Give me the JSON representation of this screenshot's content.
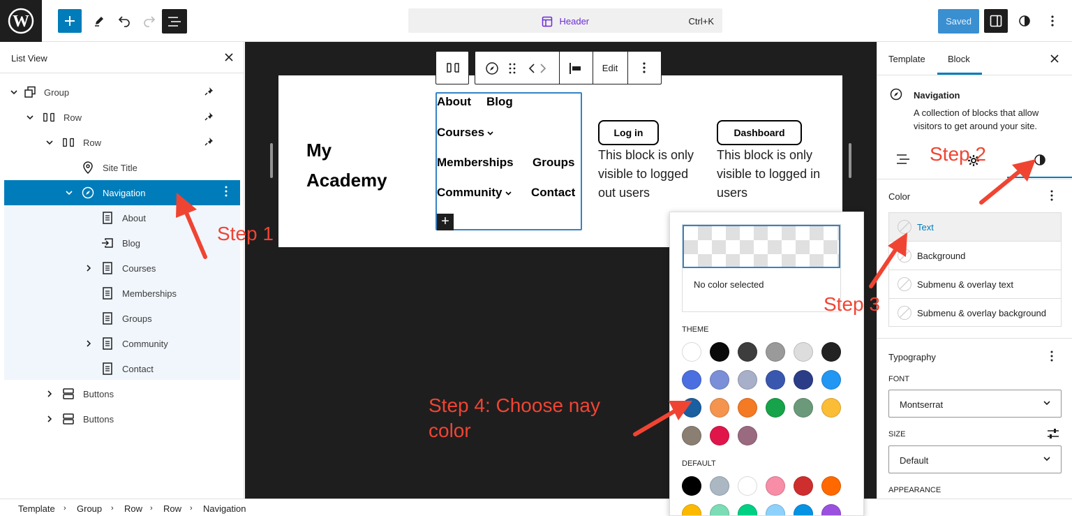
{
  "topbar": {
    "command_title": "Header",
    "command_shortcut": "Ctrl+K",
    "saved_label": "Saved"
  },
  "list_view": {
    "title": "List View",
    "items": [
      {
        "label": "Group",
        "icon": "group-icon"
      },
      {
        "label": "Row",
        "icon": "row-icon"
      },
      {
        "label": "Row",
        "icon": "row-icon"
      },
      {
        "label": "Site Title",
        "icon": "map-marker-icon"
      },
      {
        "label": "Navigation",
        "icon": "compass-icon",
        "selected": true
      },
      {
        "label": "About",
        "icon": "page-icon"
      },
      {
        "label": "Blog",
        "icon": "custom-link-icon"
      },
      {
        "label": "Courses",
        "icon": "page-icon"
      },
      {
        "label": "Memberships",
        "icon": "page-icon"
      },
      {
        "label": "Groups",
        "icon": "page-icon"
      },
      {
        "label": "Community",
        "icon": "page-icon"
      },
      {
        "label": "Contact",
        "icon": "page-icon"
      },
      {
        "label": "Buttons",
        "icon": "buttons-icon"
      },
      {
        "label": "Buttons",
        "icon": "buttons-icon"
      }
    ]
  },
  "canvas": {
    "site_title_line1": "My",
    "site_title_line2": "Academy",
    "nav_items": [
      "About",
      "Blog",
      "Courses",
      "Memberships",
      "Groups",
      "Community",
      "Contact"
    ],
    "login_button": "Log in",
    "dashboard_button": "Dashboard",
    "logged_out_text": "This block is only visible to logged out users",
    "logged_in_text": "This block is only visible to logged in users",
    "toolbar_edit": "Edit"
  },
  "color_popover": {
    "no_color": "No color selected",
    "theme_label": "THEME",
    "default_label": "DEFAULT",
    "theme_colors": [
      "#ffffff",
      "#0a0a0a",
      "#3d3d3d",
      "#9a9a9a",
      "#dddddd",
      "#222222",
      "#4b6fe0",
      "#7a8fd8",
      "#a7b0c8",
      "#3a57b0",
      "#2c3d88",
      "#2196f3",
      "#1a5fa0",
      "#f5944f",
      "#f47a24",
      "#16a34a",
      "#6b9a7a",
      "#fbbd36",
      "#8a7f72",
      "#e0164a",
      "#9a6a80"
    ],
    "default_colors": [
      "#000000",
      "#abb8c3",
      "#ffffff",
      "#f78da7",
      "#cf2e2e",
      "#ff6900",
      "#fcb900",
      "#7bdcb5",
      "#00d084",
      "#8ed1fc",
      "#0693e3",
      "#9b51e0"
    ]
  },
  "sidebar": {
    "tab_template": "Template",
    "tab_block": "Block",
    "block_title": "Navigation",
    "block_description": "A collection of blocks that allow visitors to get around your site.",
    "color_title": "Color",
    "color_items": [
      "Text",
      "Background",
      "Submenu & overlay text",
      "Submenu & overlay background"
    ],
    "typography_title": "Typography",
    "font_label": "FONT",
    "font_value": "Montserrat",
    "size_label": "SIZE",
    "size_value": "Default",
    "appearance_label": "APPEARANCE"
  },
  "breadcrumb": [
    "Template",
    "Group",
    "Row",
    "Row",
    "Navigation"
  ],
  "annotations": {
    "step1": "Step 1",
    "step2": "Step 2",
    "step3": "Step 3",
    "step4_line1": "Step 4: Choose nay",
    "step4_line2": "color"
  },
  "colors": {
    "accent": "#007cba",
    "annotation": "#f04433"
  }
}
